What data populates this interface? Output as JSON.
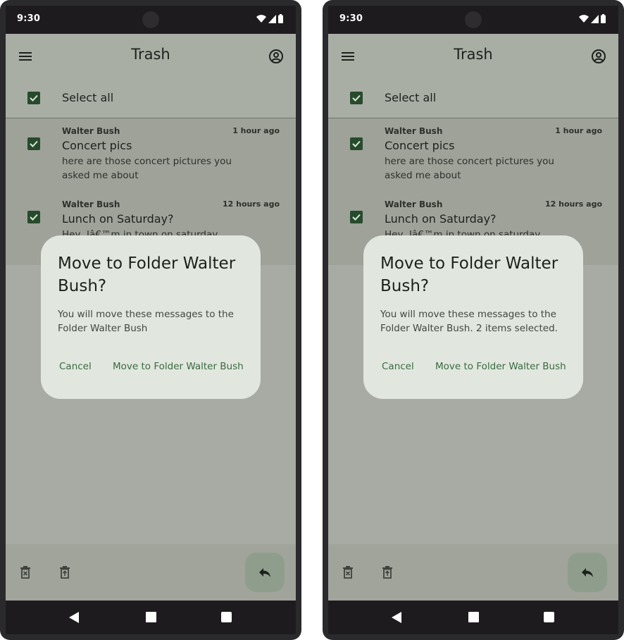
{
  "phones": [
    {
      "status_time": "9:30",
      "app_title": "Trash",
      "select_all_label": "Select all",
      "messages": [
        {
          "sender": "Walter Bush",
          "time": "1 hour ago",
          "subject": "Concert pics",
          "preview": "here are those concert pictures you asked me about"
        },
        {
          "sender": "Walter Bush",
          "time": "12 hours ago",
          "subject": "Lunch on Saturday?",
          "preview": "Hey, Iâ€™m in town on saturday"
        }
      ],
      "dialog": {
        "title": "Move to Folder Walter Bush?",
        "body": "You will move these messages to the Folder Walter Bush",
        "cancel_label": "Cancel",
        "confirm_label": "Move to Folder Walter Bush"
      }
    },
    {
      "status_time": "9:30",
      "app_title": "Trash",
      "select_all_label": "Select all",
      "messages": [
        {
          "sender": "Walter Bush",
          "time": "1 hour ago",
          "subject": "Concert pics",
          "preview": "here are those concert pictures you asked me about"
        },
        {
          "sender": "Walter Bush",
          "time": "12 hours ago",
          "subject": "Lunch on Saturday?",
          "preview": "Hey, Iâ€™m in town on saturday"
        }
      ],
      "dialog": {
        "title": "Move to Folder Walter Bush?",
        "body": "You will move these messages to the Folder Walter Bush. 2 items selected.",
        "cancel_label": "Cancel",
        "confirm_label": "Move to Folder Walter Bush"
      }
    }
  ],
  "icons": {
    "menu": "menu-icon",
    "account": "account-circle-icon",
    "delete_forever": "delete-forever-icon",
    "restore": "restore-from-trash-icon",
    "reply": "reply-icon"
  },
  "colors": {
    "checkbox": "#274a2d",
    "accent_text": "#3a6a40",
    "dialog_bg": "#e1e7de",
    "scrim_bg": "#a7aba3"
  }
}
